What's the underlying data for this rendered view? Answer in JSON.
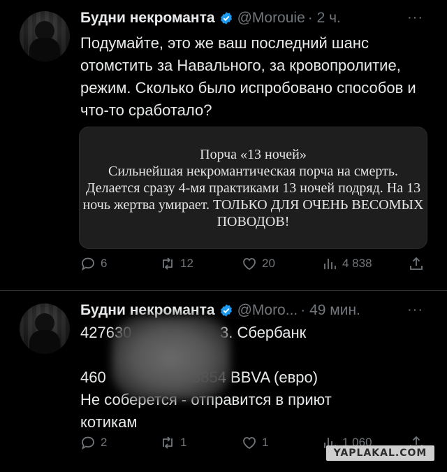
{
  "tweets": [
    {
      "author": "Будни некроманта",
      "handle": "@Morouie",
      "time": "· 2 ч.",
      "text": "Подумайте, это же ваш последний шанс отомстить за Навального, за кровопролитие, режим. Сколько было испробовано способов и что-то сработало?",
      "card_text": "Порча «13 ночей»\nСильнейшая некромантическая порча на смерть. Делается сразу 4-мя практиками 13 ночей подряд. На 13 ночь жертва умирает. ТОЛЬКО ДЛЯ ОЧЕНЬ ВЕСОМЫХ ПОВОДОВ!",
      "replies": "6",
      "retweets": "12",
      "likes": "20",
      "views": "4 838"
    },
    {
      "author": "Будни некроманта",
      "handle": "@Moro...",
      "time": "· 49 мин.",
      "text_line1_a": "427630",
      "text_line1_b": "3. Сбербанк",
      "text_line2_a": "460",
      "text_line2_b": "3854 BBVA (евро)",
      "text_rest": "Не соберется - отправится в приют котикам",
      "replies": "2",
      "retweets": "1",
      "likes": "1",
      "views": "1 060"
    }
  ],
  "more_label": "···",
  "watermark": "YAPLAKAL.COM",
  "colors": {
    "background": "#000000",
    "text": "#e7e9ea",
    "muted": "#71767b",
    "verified": "#1d9bf0"
  },
  "icons": [
    "verified-badge-icon",
    "reply-icon",
    "retweet-icon",
    "like-icon",
    "views-icon",
    "share-icon",
    "more-icon"
  ]
}
